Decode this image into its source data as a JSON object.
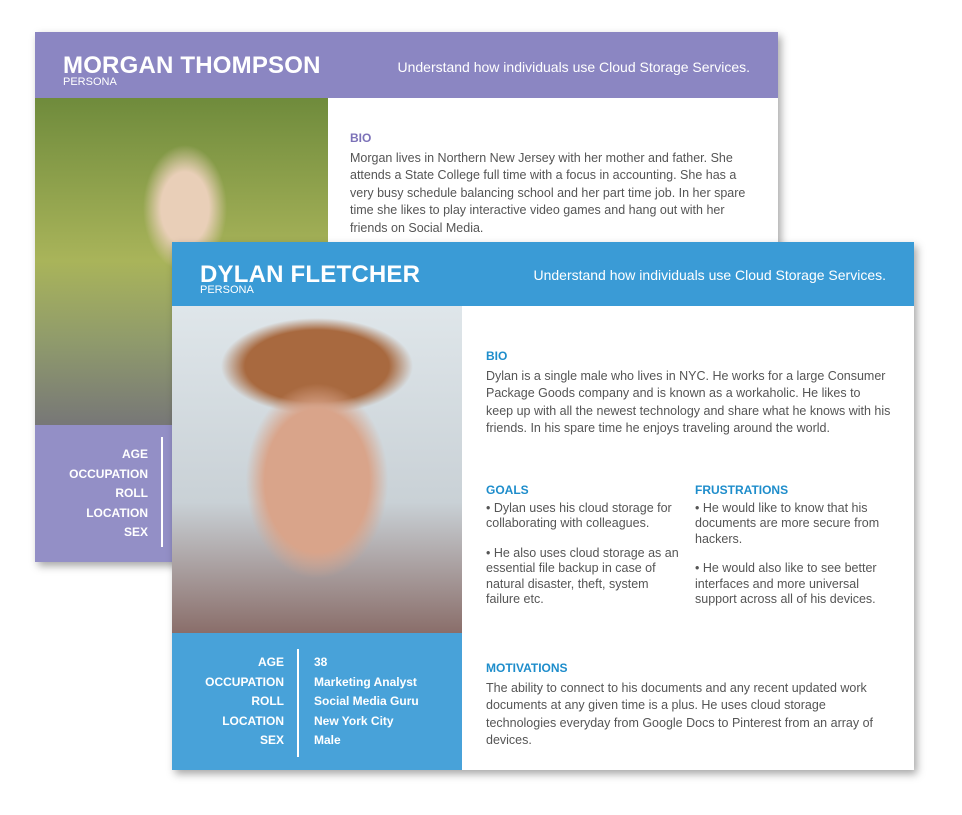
{
  "personas": [
    {
      "name": "MORGAN THOMPSON",
      "subtitle": "PERSONA",
      "tagline": "Understand how individuals use Cloud Storage Services.",
      "accent": "#8b86c2",
      "bio_title": "BIO",
      "bio": "Morgan lives in Northern New Jersey with her mother and father. She attends a State College full time with a focus in accounting. She has a very busy schedule balancing school and her part time job. In her spare time she likes to play interactive video games and hang out with her friends on Social Media.",
      "labels": [
        "AGE",
        "OCCUPATION",
        "ROLL",
        "LOCATION",
        "SEX"
      ]
    },
    {
      "name": "DYLAN FLETCHER",
      "subtitle": "PERSONA",
      "tagline": "Understand how individuals use Cloud Storage Services.",
      "accent": "#3a9bd6",
      "bio_title": "BIO",
      "bio": "Dylan is a single male who lives in NYC. He works for a large Consumer Package Goods company and is known as a workaholic. He likes to keep up with all the newest technology and share what he knows with his friends. In his spare time he enjoys traveling around the world.",
      "goals_title": "GOALS",
      "goals": [
        "• Dylan uses his cloud storage for collaborating with colleagues.",
        "• He also uses cloud storage as an essential file backup in case of natural disaster, theft, system failure etc."
      ],
      "frustrations_title": "FRUSTRATIONS",
      "frustrations": [
        "• He would like to know that his documents are more secure from hackers.",
        "• He would also like to see better interfaces and more universal support across all of his devices."
      ],
      "motivations_title": "MOTIVATIONS",
      "motivations": "The ability to connect to his documents and any recent updated work documents at any given time is a plus. He uses cloud storage technologies everyday from Google Docs to Pinterest from an array of devices.",
      "labels": [
        "AGE",
        "OCCUPATION",
        "ROLL",
        "LOCATION",
        "SEX"
      ],
      "values": [
        "38",
        "Marketing Analyst",
        "Social Media Guru",
        "New York City",
        "Male"
      ]
    }
  ]
}
